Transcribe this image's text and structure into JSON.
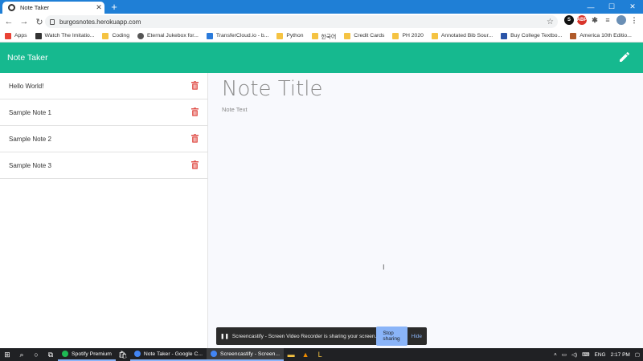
{
  "browser": {
    "tab_title": "Note Taker",
    "url": "burgosnotes.herokuapp.com",
    "bookmarks": [
      {
        "label": "Apps",
        "icon": "apps-grid-icon",
        "color": "#e94235"
      },
      {
        "label": "Watch The Imitatio...",
        "icon": "site-icon",
        "color": "#333333"
      },
      {
        "label": "Coding",
        "icon": "folder-icon",
        "color": "#f5c342"
      },
      {
        "label": "Eternal Jukebox for...",
        "icon": "globe-icon",
        "color": "#555555"
      },
      {
        "label": "TransferCloud.io - b...",
        "icon": "site-icon",
        "color": "#2b7bdb"
      },
      {
        "label": "Python",
        "icon": "folder-icon",
        "color": "#f5c342"
      },
      {
        "label": "한국어",
        "icon": "folder-icon",
        "color": "#f5c342"
      },
      {
        "label": "Credit Cards",
        "icon": "folder-icon",
        "color": "#f5c342"
      },
      {
        "label": "PH 2020",
        "icon": "folder-icon",
        "color": "#f5c342"
      },
      {
        "label": "Annotated Bib Sour...",
        "icon": "folder-icon",
        "color": "#f5c342"
      },
      {
        "label": "Buy College Textbo...",
        "icon": "site-icon",
        "color": "#2b55a8"
      },
      {
        "label": "America 10th Editio...",
        "icon": "site-icon",
        "color": "#b05a2a"
      }
    ]
  },
  "app": {
    "title": "Note Taker",
    "accent": "#16b98f"
  },
  "notes": [
    {
      "title": "Hello World!"
    },
    {
      "title": "Sample Note 1"
    },
    {
      "title": "Sample Note 2"
    },
    {
      "title": "Sample Note 3"
    }
  ],
  "editor": {
    "title_placeholder": "Note Title",
    "text_placeholder": "Note Text"
  },
  "screencast": {
    "message": "Screencastify - Screen Video Recorder is sharing your screen.",
    "stop_label": "Stop sharing",
    "hide_label": "Hide"
  },
  "taskbar": {
    "apps": [
      {
        "label": "Spotify Premium",
        "color": "#1db954"
      },
      {
        "label": "Note Taker - Google C...",
        "color": "#4285f4"
      },
      {
        "label": "Screencastify - Screen...",
        "color": "#4285f4"
      }
    ],
    "language": "ENG",
    "time": "2:17 PM"
  }
}
